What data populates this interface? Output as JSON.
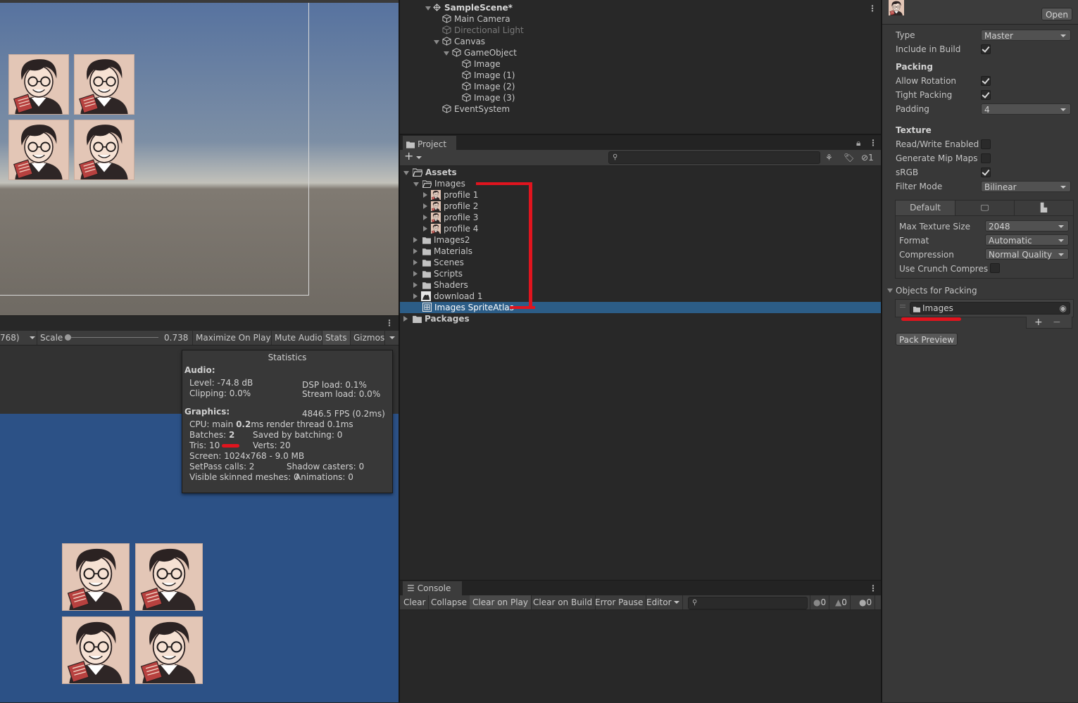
{
  "scene_view": {
    "sprite_count": 4
  },
  "game_toolbar": {
    "resolution_suffix": "768)",
    "scale_label": "Scale",
    "scale_value": "0.738",
    "maximize_on_play": "Maximize On Play",
    "mute_audio": "Mute Audio",
    "stats": "Stats",
    "gizmos": "Gizmos"
  },
  "stats": {
    "title": "Statistics",
    "audio_header": "Audio:",
    "level": "Level: -74.8 dB",
    "dsp_load": "DSP load: 0.1%",
    "clipping": "Clipping: 0.0%",
    "stream_load": "Stream load: 0.0%",
    "graphics_header": "Graphics:",
    "fps": "4846.5 FPS (0.2ms)",
    "cpu_prefix": "CPU: main ",
    "cpu_main": "0.2",
    "cpu_suffix": "ms  render thread 0.1ms",
    "batches_prefix": "Batches: ",
    "batches": "2",
    "saved_by_batching": "Saved by batching: 0",
    "tris": "Tris: 10",
    "verts": "Verts: 20",
    "screen": "Screen: 1024x768 - 9.0 MB",
    "setpass": "SetPass calls: 2",
    "shadow_casters": "Shadow casters: 0",
    "skinned": "Visible skinned meshes: 0",
    "animations": "Animations: 0"
  },
  "hierarchy": {
    "scene": "SampleScene*",
    "items": [
      {
        "label": "Main Camera"
      },
      {
        "label": "Directional Light"
      },
      {
        "label": "Canvas"
      },
      {
        "label": "GameObject"
      },
      {
        "label": "Image"
      },
      {
        "label": "Image (1)"
      },
      {
        "label": "Image (2)"
      },
      {
        "label": "Image (3)"
      },
      {
        "label": "EventSystem"
      }
    ]
  },
  "project": {
    "tab": "Project",
    "hidden_count": "1",
    "tree": [
      {
        "label": "Assets"
      },
      {
        "label": "Images"
      },
      {
        "label": "profile 1"
      },
      {
        "label": "profile 2"
      },
      {
        "label": "profile 3"
      },
      {
        "label": "profile 4"
      },
      {
        "label": "Images2"
      },
      {
        "label": "Materials"
      },
      {
        "label": "Scenes"
      },
      {
        "label": "Scripts"
      },
      {
        "label": "Shaders"
      },
      {
        "label": "download 1"
      },
      {
        "label": "Images SpriteAtlas"
      },
      {
        "label": "Packages"
      }
    ]
  },
  "console": {
    "tab": "Console",
    "clear": "Clear",
    "collapse": "Collapse",
    "clear_on_play": "Clear on Play",
    "clear_on_build": "Clear on Build",
    "error_pause": "Error Pause",
    "editor": "Editor",
    "log_count": "0",
    "warn_count": "0",
    "error_count": "0"
  },
  "inspector": {
    "open_button": "Open",
    "type_label": "Type",
    "type_value": "Master",
    "include_in_build": "Include in Build",
    "packing_header": "Packing",
    "allow_rotation": "Allow Rotation",
    "tight_packing": "Tight Packing",
    "padding_label": "Padding",
    "padding_value": "4",
    "texture_header": "Texture",
    "read_write": "Read/Write Enabled",
    "mip_maps": "Generate Mip Maps",
    "srgb": "sRGB",
    "filter_mode": "Filter Mode",
    "filter_value": "Bilinear",
    "platform_default": "Default",
    "max_texture_size": "Max Texture Size",
    "max_texture_value": "2048",
    "format_label": "Format",
    "format_value": "Automatic",
    "compression_label": "Compression",
    "compression_value": "Normal Quality",
    "crunch_label": "Use Crunch Compres",
    "objects_header": "Objects for Packing",
    "object_item": "Images",
    "pack_preview": "Pack Preview",
    "checks": {
      "include_in_build": true,
      "allow_rotation": true,
      "tight_packing": true,
      "read_write": false,
      "mip_maps": false,
      "srgb": true,
      "crunch": false
    }
  },
  "colors": {
    "selection": "#2c5d87",
    "annotation": "#e0141e",
    "game_bg": "#2c5186"
  }
}
